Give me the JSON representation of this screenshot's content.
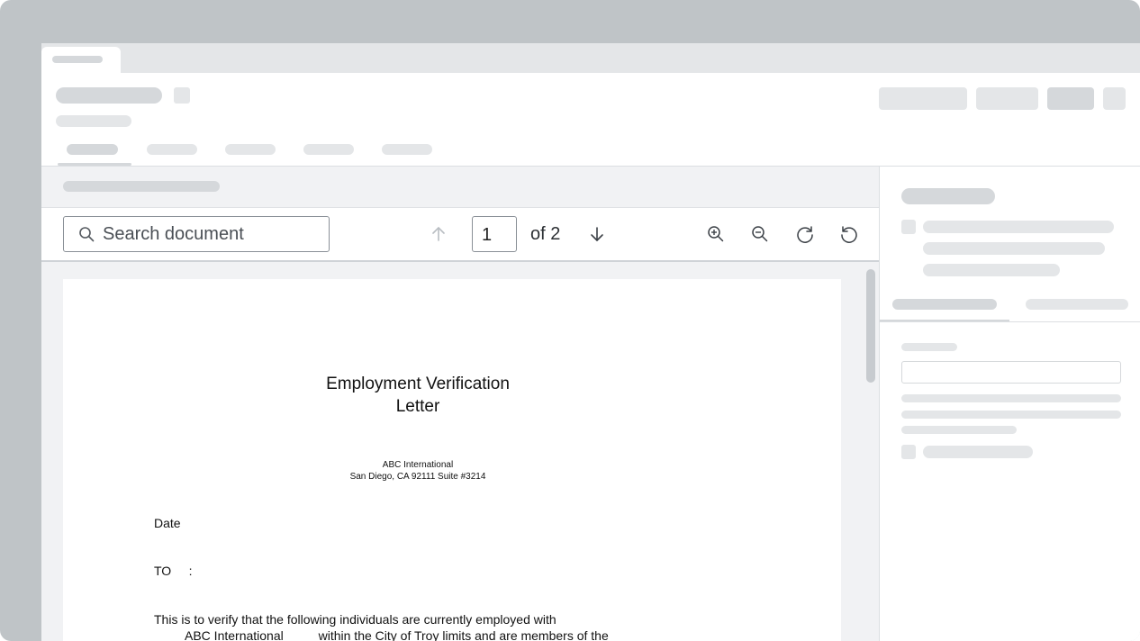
{
  "viewer": {
    "search": {
      "placeholder": "Search document"
    },
    "pagination": {
      "current_page": "1",
      "of_label": "of 2"
    },
    "icons": {
      "search": "search-icon",
      "prev": "arrow-up-icon",
      "next": "arrow-down-icon",
      "zoom_in": "zoom-in-icon",
      "zoom_out": "zoom-out-icon",
      "rotate_cw": "rotate-clockwise-icon",
      "rotate_ccw": "rotate-counterclockwise-icon"
    }
  },
  "document": {
    "title_line1": "Employment Verification",
    "title_line2": "Letter",
    "company_name": "ABC International",
    "company_address": "San Diego, CA 92111 Suite #3214",
    "date_label": "Date",
    "to_label": "TO     :",
    "body_line1": "This is to verify that the following individuals are currently employed with",
    "body_line2": "ABC International          within the City of Troy limits and are members of the"
  },
  "colors": {
    "backdrop": "#bfc4c7",
    "skeleton": "#e4e6e8",
    "skeleton_dark": "#d5d8db",
    "viewer_bg": "#f1f2f4"
  }
}
